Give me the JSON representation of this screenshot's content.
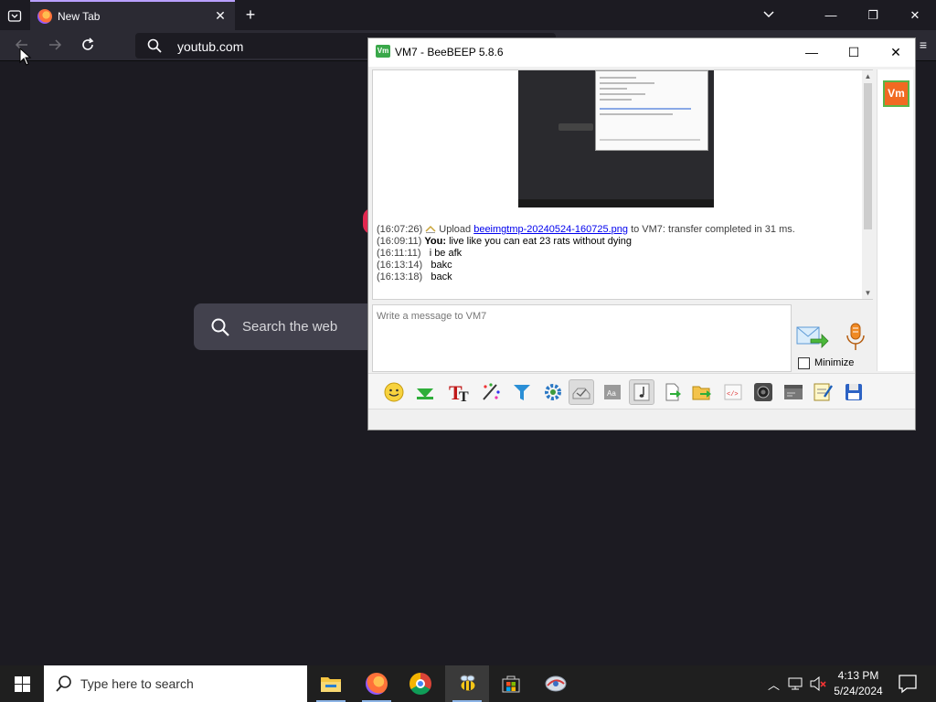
{
  "browser": {
    "tab_title": "New Tab",
    "url_text": "youtub.com",
    "newtab_search_placeholder": "Search the web"
  },
  "beebeep": {
    "window_title": "VM7 - BeeBEEP 5.8.6",
    "title_badge": "Vm",
    "avatar_label": "Vm",
    "messages": [
      {
        "time": "(16:07:26)",
        "prefix": "Upload",
        "link": "beeimgtmp-20240524-160725.png",
        "suffix": "to VM7: transfer completed in 31 ms."
      },
      {
        "time": "(16:09:11)",
        "user": "You:",
        "text": "live like you can eat 23 rats without dying"
      },
      {
        "time": "(16:11:11)",
        "text": "i be afk"
      },
      {
        "time": "(16:13:14)",
        "text": "bakc"
      },
      {
        "time": "(16:13:18)",
        "text": "back"
      }
    ],
    "input_placeholder": "Write a message to VM7",
    "minimize_label": "Minimize",
    "toolbar_icons": [
      "smiley-icon",
      "green-arrow-icon",
      "text-font-icon",
      "color-picker-icon",
      "filter-icon",
      "settings-gear-icon",
      "tray-icon",
      "font-icon",
      "music-note-icon",
      "send-file-icon",
      "send-folder-icon",
      "code-icon",
      "webcam-icon",
      "terminal-icon",
      "notepad-icon",
      "save-icon"
    ],
    "accent_colors": {
      "vm_orange": "#f16a22",
      "vm_green": "#58b548",
      "link_blue": "#0000ee"
    }
  },
  "taskbar": {
    "search_placeholder": "Type here to search",
    "time": "4:13 PM",
    "date": "5/24/2024"
  }
}
